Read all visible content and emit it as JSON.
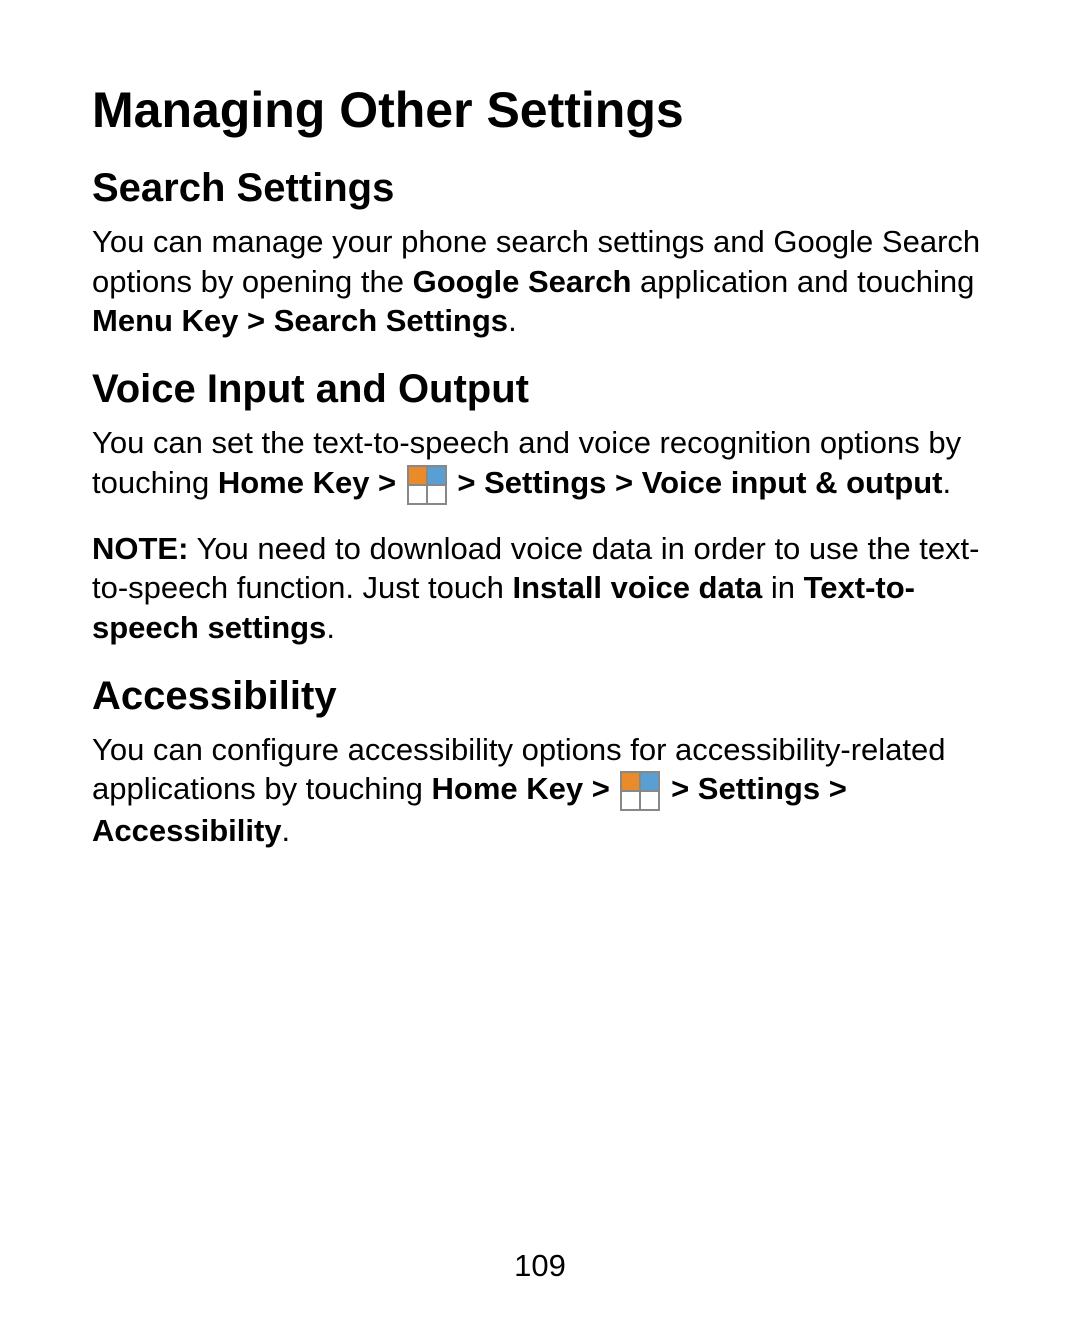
{
  "title": "Managing Other Settings",
  "sections": {
    "search": {
      "heading": "Search Settings",
      "p1a": "You can manage your phone search settings and Google Search options by opening the ",
      "p1b": "Google Search",
      "p1c": " application and touching ",
      "p1d": "Menu Key > Search Settings",
      "p1e": "."
    },
    "voice": {
      "heading": "Voice Input and Output",
      "p1a": "You can set the text-to-speech and voice recognition options by touching ",
      "p1b": "Home Key > ",
      "p1c": " > Settings > Voice input & output",
      "p1d": ".",
      "p2a": "NOTE:",
      "p2b": " You need to download voice data in order to use the text-to-speech function. Just touch ",
      "p2c": "Install voice data",
      "p2d": " in ",
      "p2e": "Text-to-speech settings",
      "p2f": "."
    },
    "accessibility": {
      "heading": "Accessibility",
      "p1a": "You can configure accessibility options for accessibility-related applications by touching ",
      "p1b": "Home Key > ",
      "p1c": " > Settings > Accessibility",
      "p1d": "."
    }
  },
  "page_number": "109"
}
